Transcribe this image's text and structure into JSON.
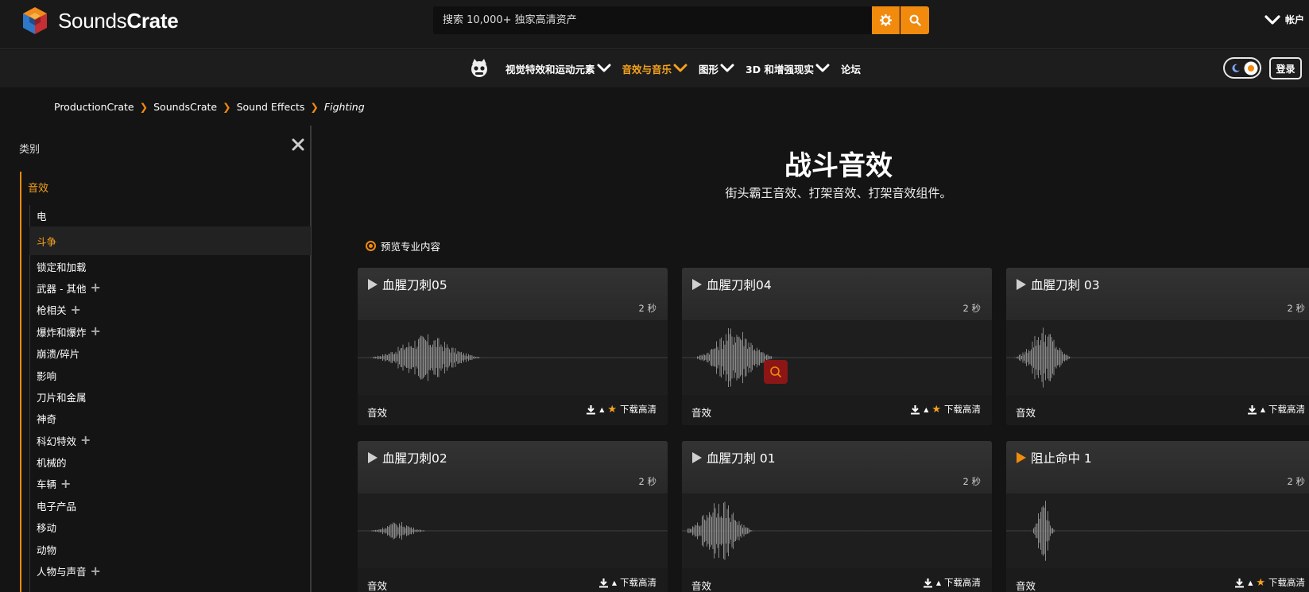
{
  "brand": {
    "logo_word_light": "Sounds",
    "logo_word_bold": "Crate"
  },
  "search": {
    "placeholder": "搜索 10,000+ 独家高清资产"
  },
  "account_label": "帐户",
  "nav": {
    "items": [
      {
        "label": "视觉特效和运动元素",
        "dropdown": true,
        "active": false
      },
      {
        "label": "音效与音乐",
        "dropdown": true,
        "active": true
      },
      {
        "label": "图形",
        "dropdown": true,
        "active": false
      },
      {
        "label": "3D 和增强现实",
        "dropdown": true,
        "active": false
      },
      {
        "label": "论坛",
        "dropdown": false,
        "active": false
      }
    ],
    "login_label": "登录"
  },
  "breadcrumb": [
    "ProductionCrate",
    "SoundsCrate",
    "Sound Effects",
    "Fighting"
  ],
  "sidebar": {
    "title": "类别",
    "main_category": "音效",
    "items": [
      {
        "label": "电",
        "expandable": false
      },
      {
        "label": "斗争",
        "expandable": false,
        "active": true
      },
      {
        "label": "锁定和加载",
        "expandable": false
      },
      {
        "label": "武器 - 其他",
        "expandable": true
      },
      {
        "label": "枪相关",
        "expandable": true
      },
      {
        "label": "爆炸和爆炸",
        "expandable": true
      },
      {
        "label": "崩溃/碎片",
        "expandable": false
      },
      {
        "label": "影响",
        "expandable": false
      },
      {
        "label": "刀片和金属",
        "expandable": false
      },
      {
        "label": "神奇",
        "expandable": false
      },
      {
        "label": "科幻特效",
        "expandable": true
      },
      {
        "label": "机械的",
        "expandable": false
      },
      {
        "label": "车辆",
        "expandable": true
      },
      {
        "label": "电子产品",
        "expandable": false
      },
      {
        "label": "移动",
        "expandable": false
      },
      {
        "label": "动物",
        "expandable": false
      },
      {
        "label": "人物与声音",
        "expandable": true
      }
    ]
  },
  "main": {
    "title": "战斗音效",
    "subtitle": "街头霸王音效、打架音效、打架音效组件。",
    "preview_pro_label": "预览专业内容"
  },
  "cards": [
    {
      "title": "血腥刀刺05",
      "duration": "2 秒",
      "category": "音效",
      "download_label": "下载高清",
      "starred": true,
      "play_color": "#cfcfcf"
    },
    {
      "title": "血腥刀刺04",
      "duration": "2 秒",
      "category": "音效",
      "download_label": "下载高清",
      "starred": true,
      "play_color": "#cfcfcf"
    },
    {
      "title": "血腥刀刺 03",
      "duration": "2 秒",
      "category": "音效",
      "download_label": "下载高清",
      "starred": false,
      "play_color": "#cfcfcf"
    },
    {
      "title": "血腥刀刺02",
      "duration": "2 秒",
      "category": "音效",
      "download_label": "下载高清",
      "starred": false,
      "play_color": "#cfcfcf"
    },
    {
      "title": "血腥刀刺 01",
      "duration": "2 秒",
      "category": "音效",
      "download_label": "下载高清",
      "starred": false,
      "play_color": "#cfcfcf"
    },
    {
      "title": "阻止命中 1",
      "duration": "2 秒",
      "category": "音效",
      "download_label": "下载高清",
      "starred": true,
      "play_color": "#f18a0d"
    }
  ],
  "colors": {
    "accent": "#f18a0d",
    "highlight": "#f6a21e",
    "bg": "#141414"
  }
}
